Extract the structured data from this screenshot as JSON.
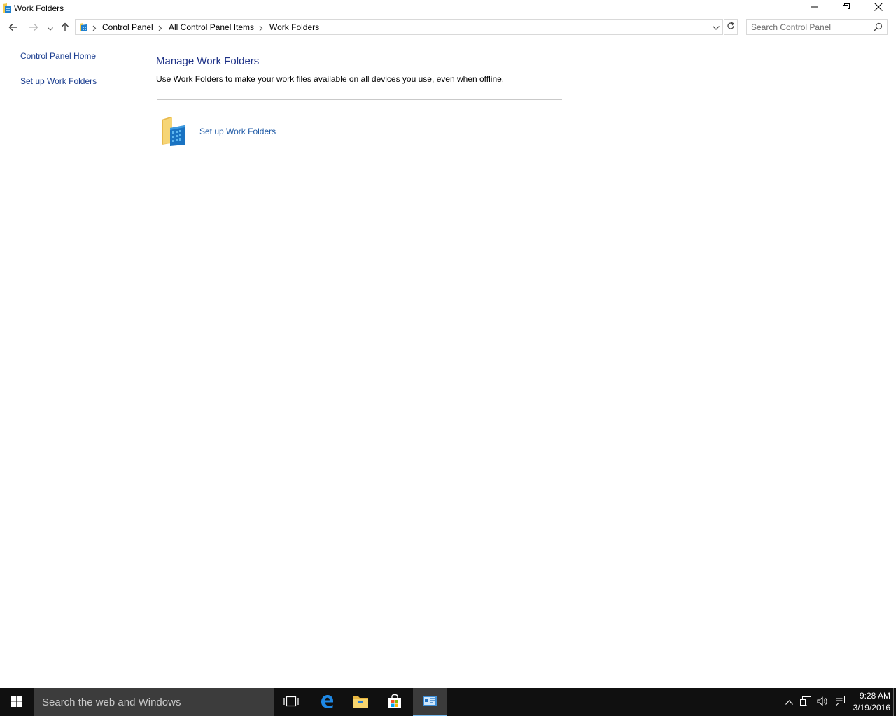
{
  "window": {
    "title": "Work Folders"
  },
  "address_bar": {
    "breadcrumbs": [
      "Control Panel",
      "All Control Panel Items",
      "Work Folders"
    ]
  },
  "search": {
    "placeholder": "Search Control Panel"
  },
  "left_pane": {
    "home_link": "Control Panel Home",
    "setup_link": "Set up Work Folders"
  },
  "main": {
    "title": "Manage Work Folders",
    "description": "Use Work Folders to make your work files available on all devices you use, even when offline.",
    "task_link": "Set up Work Folders"
  },
  "taskbar": {
    "search_text": "Search the web and Windows",
    "time": "9:28 AM",
    "date": "3/19/2016"
  },
  "colors": {
    "link": "#1f5aa6",
    "title": "#1e3287",
    "taskbar": "#101010",
    "taskbar_search": "#3c3c3c",
    "active_indicator": "#76b9ed"
  }
}
